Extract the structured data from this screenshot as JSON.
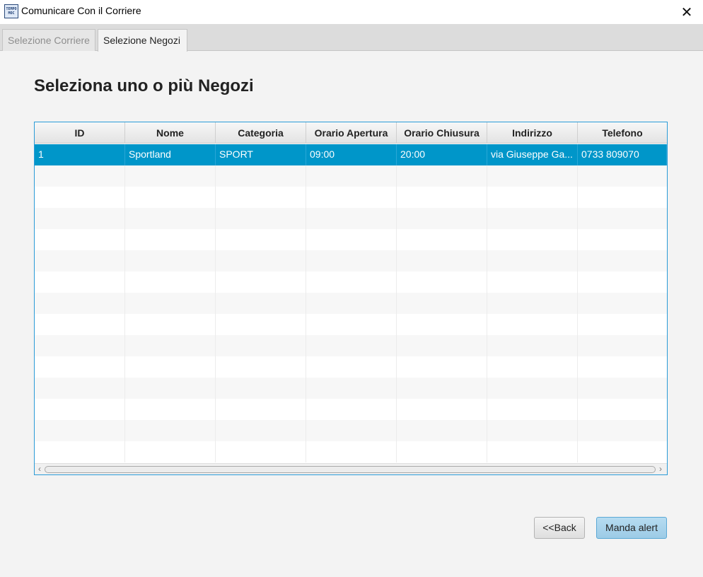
{
  "window": {
    "title": "Comunicare Con il Corriere",
    "icon_name": "app-logo-icon",
    "icon_text_line1": "TEMPO",
    "icon_text_line2": "MOC",
    "close_glyph": "✕"
  },
  "tabs": [
    {
      "label": "Selezione Corriere",
      "active": false
    },
    {
      "label": "Selezione Negozi",
      "active": true
    }
  ],
  "main": {
    "heading": "Seleziona uno o più Negozi"
  },
  "table": {
    "columns": [
      "ID",
      "Nome",
      "Categoria",
      "Orario Apertura",
      "Orario Chiusura",
      "Indirizzo",
      "Telefono"
    ],
    "rows": [
      {
        "id": "1",
        "nome": "Sportland",
        "categoria": "SPORT",
        "apertura": "09:00",
        "chiusura": "20:00",
        "indirizzo": "via Giuseppe Ga...",
        "telefono": "0733 809070",
        "selected": true
      }
    ],
    "selection_color": "#0096c9"
  },
  "scrollbar": {
    "left_arrow": "‹",
    "right_arrow": "›"
  },
  "buttons": {
    "back_label": "<<Back",
    "send_label": "Manda alert"
  },
  "colors": {
    "accent_border": "#2a9bd7",
    "primary_button": "#a8d3ec"
  }
}
